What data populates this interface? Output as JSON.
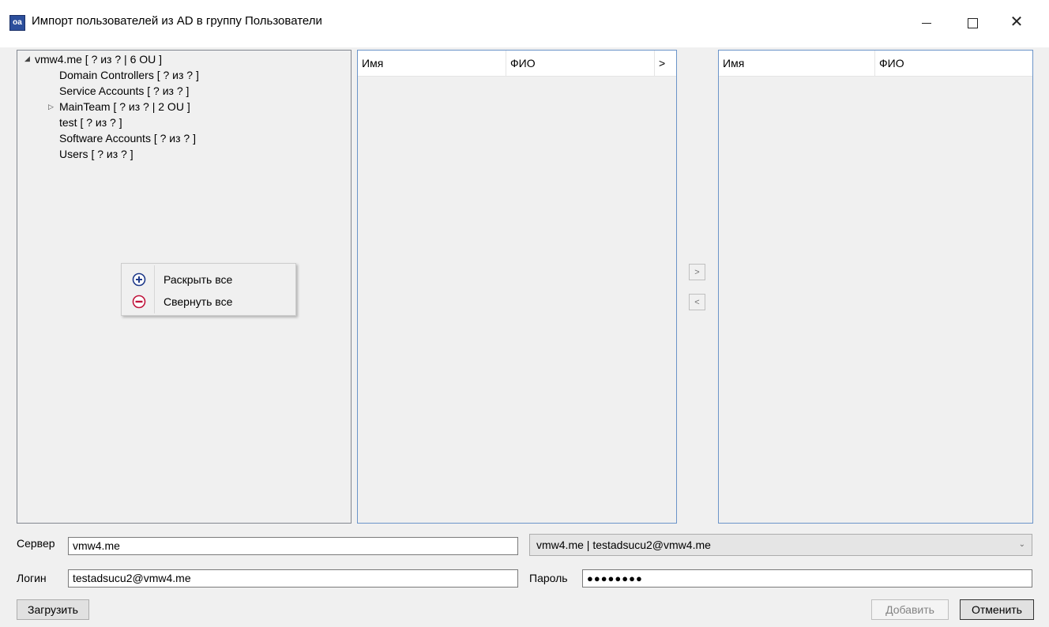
{
  "window": {
    "title": "Импорт пользователей из AD в группу Пользователи",
    "app_icon_glyph": "oa",
    "minimize_glyph": "–",
    "close_glyph": "✕"
  },
  "tree": {
    "root": {
      "label": "vmw4.me [ ? из ? | 6 OU ]",
      "arrow": "◢"
    },
    "children": [
      {
        "label": "Domain Controllers [ ? из ? ]"
      },
      {
        "label": "Service Accounts [ ? из ? ]"
      },
      {
        "label": "MainTeam [ ? из ? | 2 OU ]",
        "arrow": "▷"
      },
      {
        "label": "test [ ? из ? ]"
      },
      {
        "label": "Software Accounts [ ? из ? ]"
      },
      {
        "label": "Users [ ? из ? ]"
      }
    ]
  },
  "context_menu": {
    "items": [
      {
        "label": "Раскрыть все",
        "icon": "plus-circle-icon",
        "color": "#1f3a8a"
      },
      {
        "label": "Свернуть все",
        "icon": "minus-circle-icon",
        "color": "#c0143c"
      }
    ]
  },
  "source_list": {
    "columns": [
      "Имя",
      "ФИО"
    ],
    "overflow_glyph": ">"
  },
  "target_list": {
    "columns": [
      "Имя",
      "ФИО"
    ]
  },
  "transfer": {
    "add_glyph": ">",
    "remove_glyph": "<"
  },
  "form": {
    "server_label": "Сервер",
    "server_value": "vmw4.me",
    "login_label": "Логин",
    "login_value": "testadsucu2@vmw4.me",
    "connection_value": "vmw4.me | testadsucu2@vmw4.me",
    "password_label": "Пароль",
    "password_mask": "●●●●●●●●"
  },
  "buttons": {
    "load": "Загрузить",
    "add": "Добавить",
    "cancel": "Отменить"
  }
}
